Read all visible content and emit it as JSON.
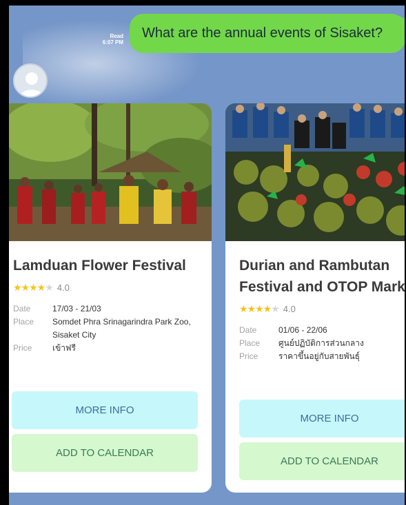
{
  "chat": {
    "read_status": "Read",
    "read_time": "6:07 PM",
    "user_message": "What are the annual events of Sisaket?"
  },
  "events": [
    {
      "title": "Lamduan Flower Festival",
      "rating": 4.0,
      "rating_text": "4.0",
      "stars_filled": 4,
      "stars_total": 5,
      "date_label": "Date",
      "date_value": "17/03 - 21/03",
      "place_label": "Place",
      "place_value": "Somdet Phra Srinagarindra Park Zoo, Sisaket City",
      "price_label": "Price",
      "price_value": "เข้าฟรี",
      "more_info_label": "MORE INFO",
      "add_calendar_label": "ADD TO CALENDAR"
    },
    {
      "title": "Durian and Rambutan Festival and OTOP Market",
      "rating": 4.0,
      "rating_text": "4.0",
      "stars_filled": 4,
      "stars_total": 5,
      "date_label": "Date",
      "date_value": "01/06 - 22/06",
      "place_label": "Place",
      "place_value": "ศูนย์ปฏิบัติการส่วนกลาง",
      "price_label": "Price",
      "price_value": "ราคาขึ้นอยู่กับสายพันธุ์",
      "more_info_label": "MORE INFO",
      "add_calendar_label": "ADD TO CALENDAR"
    }
  ],
  "colors": {
    "chat_background": "#7596c8",
    "user_bubble": "#72d84a",
    "more_info_button": "#c6f8fb",
    "calendar_button": "#d5f8cf",
    "star": "#f5c518"
  }
}
